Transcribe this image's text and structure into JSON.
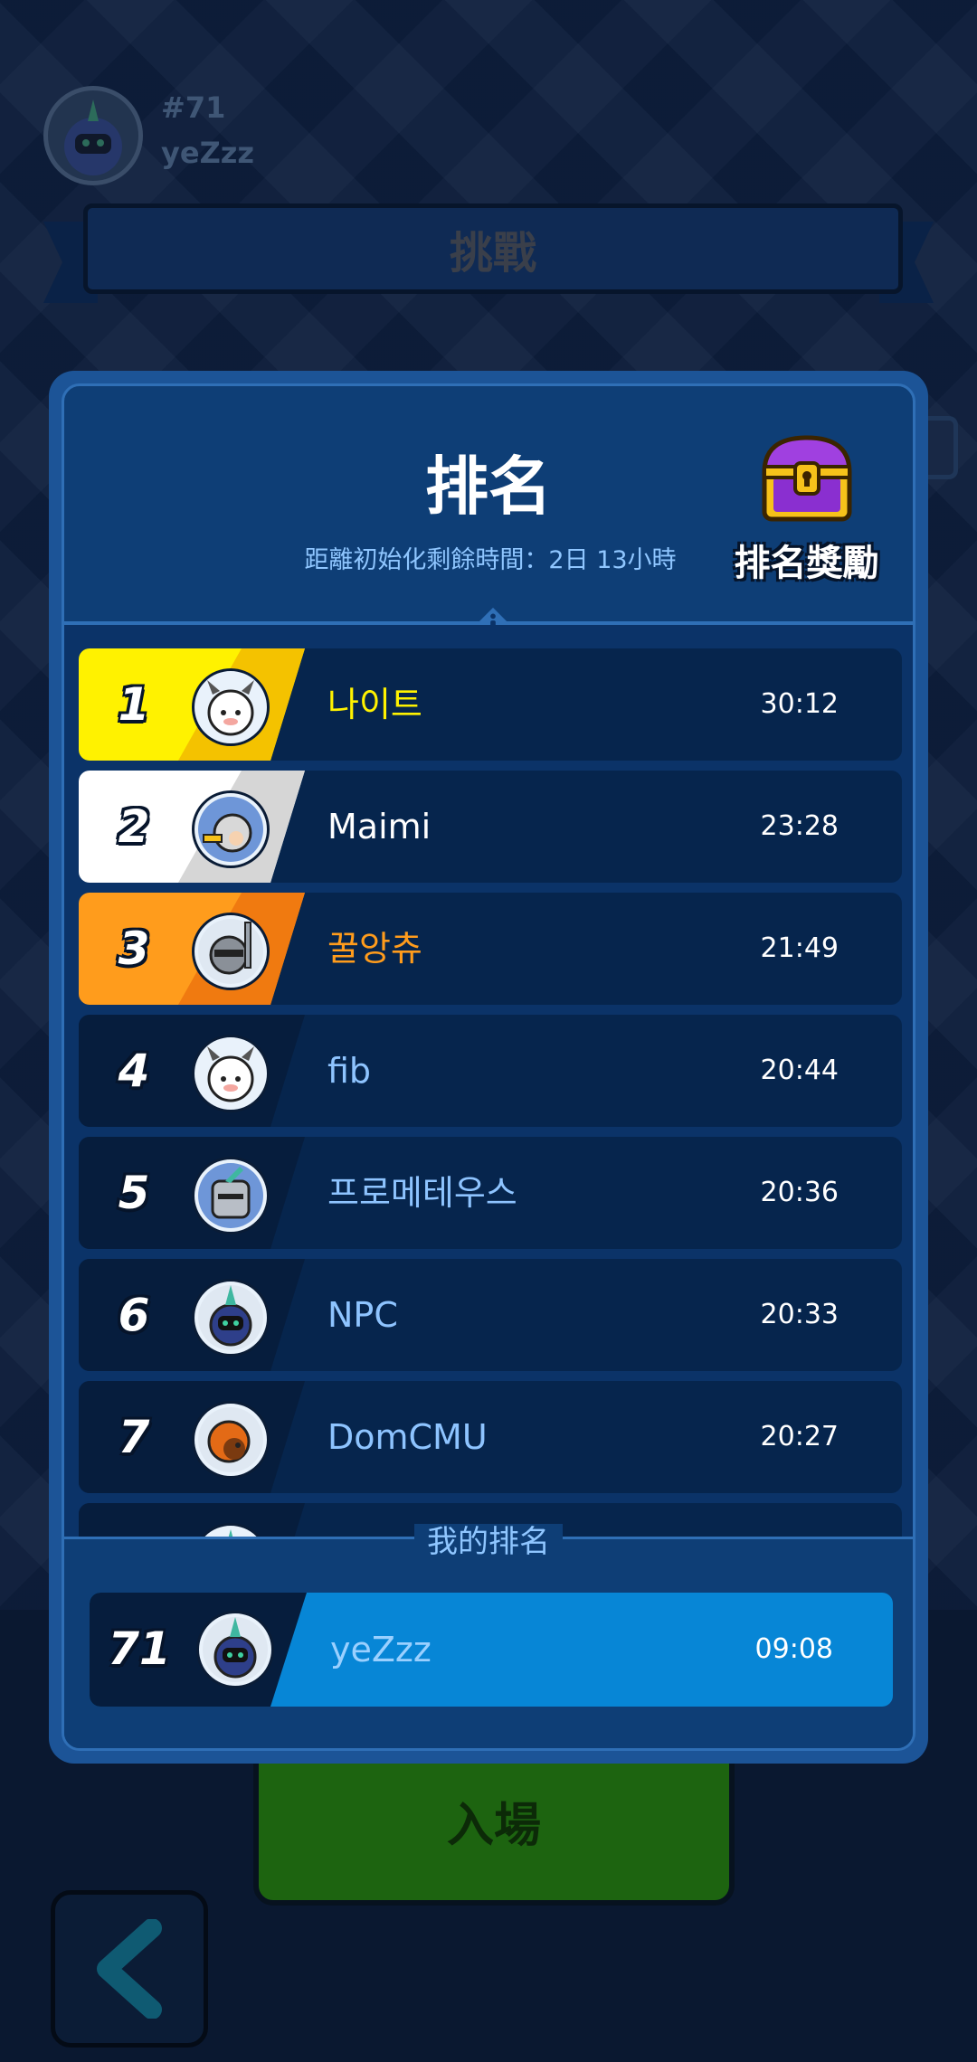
{
  "header": {
    "rank": "#71",
    "name": "yeZzz",
    "banner": "挑戰"
  },
  "modal": {
    "title": "排名",
    "subtitle": "距離初始化剩餘時間：2日 13小時",
    "reward_label": "排名獎勵"
  },
  "rows": [
    {
      "rank": "1",
      "name": "나이트",
      "time": "30:12"
    },
    {
      "rank": "2",
      "name": "Maimi",
      "time": "23:28"
    },
    {
      "rank": "3",
      "name": "꿀앙츄",
      "time": "21:49"
    },
    {
      "rank": "4",
      "name": "fib",
      "time": "20:44"
    },
    {
      "rank": "5",
      "name": "프로메테우스",
      "time": "20:36"
    },
    {
      "rank": "6",
      "name": "NPC",
      "time": "20:33"
    },
    {
      "rank": "7",
      "name": "DomCMU",
      "time": "20:27"
    }
  ],
  "my_rank": {
    "label": "我的排名",
    "rank": "71",
    "name": "yeZzz",
    "time": "09:08"
  },
  "buttons": {
    "enter": "入場"
  },
  "colors": {
    "gold": "#fff200",
    "silver": "#ffffff",
    "bronze": "#ff9c1c",
    "accent": "#0786d6"
  }
}
